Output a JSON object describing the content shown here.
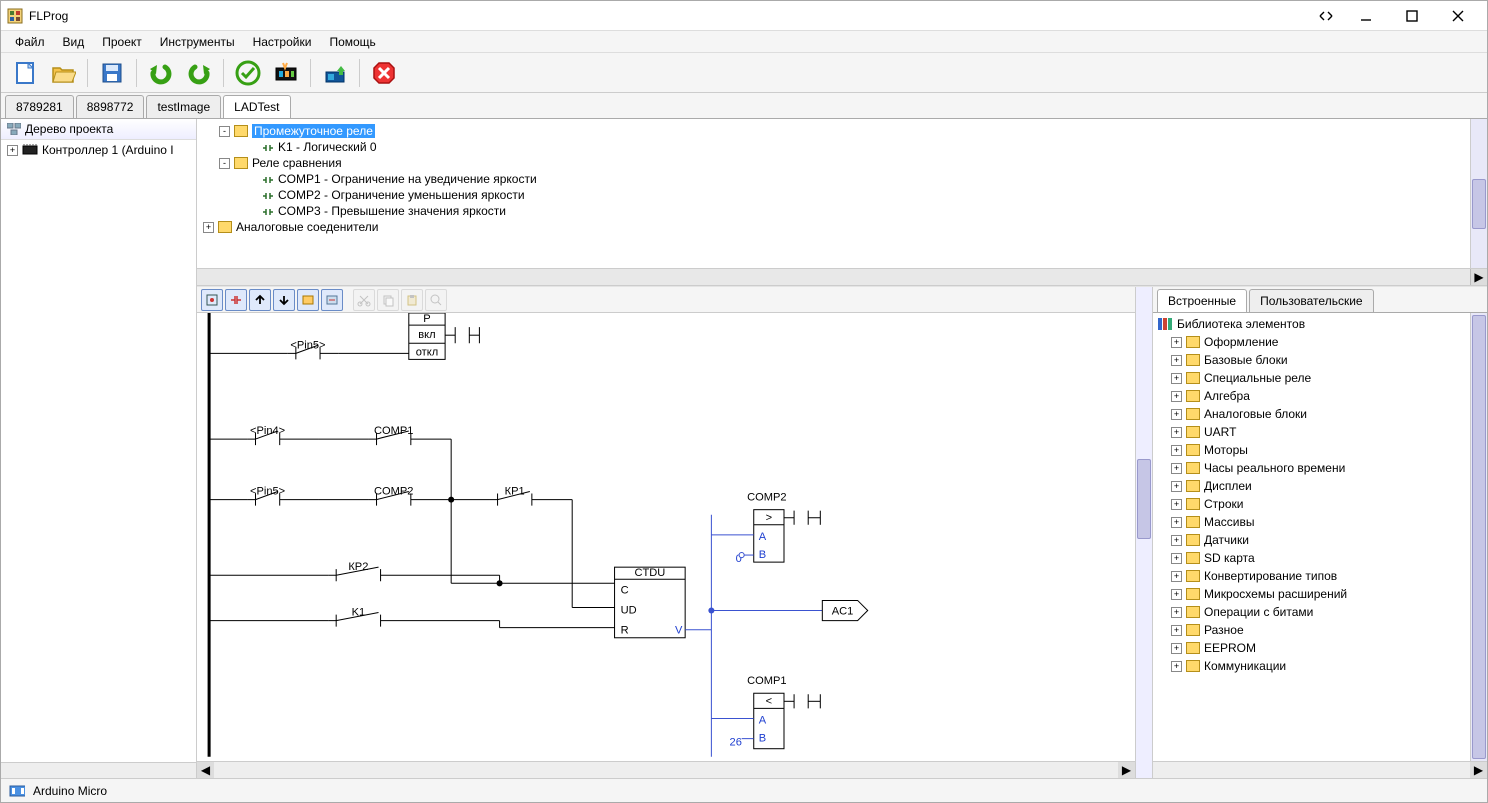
{
  "app": {
    "title": "FLProg"
  },
  "menu": [
    "Файл",
    "Вид",
    "Проект",
    "Инструменты",
    "Настройки",
    "Помощь"
  ],
  "doctabs": [
    {
      "label": "8789281",
      "active": false
    },
    {
      "label": "8898772",
      "active": false
    },
    {
      "label": "testImage",
      "active": false
    },
    {
      "label": "LADTest",
      "active": true
    }
  ],
  "leftpanel": {
    "header": "Дерево проекта",
    "items": [
      {
        "label": "Контроллер 1 (Arduino I"
      }
    ]
  },
  "uppertree": {
    "rows": [
      {
        "indent": 0,
        "exp": "-",
        "folder": true,
        "label": "Промежуточное реле",
        "selected": true
      },
      {
        "indent": 1,
        "exp": "",
        "folder": false,
        "label": "K1 - Логический 0"
      },
      {
        "indent": 0,
        "exp": "-",
        "folder": true,
        "label": "Реле сравнения"
      },
      {
        "indent": 1,
        "exp": "",
        "folder": false,
        "label": "COMP1 - Ограничение на уведичение яркости"
      },
      {
        "indent": 1,
        "exp": "",
        "folder": false,
        "label": "COMP2 - Ограничение уменьшения яркости"
      },
      {
        "indent": 1,
        "exp": "",
        "folder": false,
        "label": "COMP3 - Превышение значения яркости"
      },
      {
        "indent": -1,
        "exp": "+",
        "folder": true,
        "label": "Аналоговые соеденители"
      }
    ]
  },
  "rightpanel": {
    "tabs": [
      {
        "label": "Встроенные",
        "active": true
      },
      {
        "label": "Пользовательские",
        "active": false
      }
    ],
    "header": "Библиотека элементов",
    "items": [
      "Оформление",
      "Базовые блоки",
      "Специальные реле",
      "Алгебра",
      "Аналоговые блоки",
      "UART",
      "Моторы",
      "Часы реального времени",
      "Дисплеи",
      "Строки",
      "Массивы",
      "Датчики",
      "SD карта",
      "Конвертирование типов",
      "Микросхемы расширений",
      "Операции с битами",
      "Разное",
      "EEPROM",
      "Коммуникации"
    ]
  },
  "statusbar": {
    "board": "Arduino Micro"
  },
  "ladder": {
    "block_top": {
      "p": "P",
      "on": "вкл",
      "off": "откл"
    },
    "pin5a": "<Pin5>",
    "pin4": "<Pin4>",
    "comp1_top": "COMP1",
    "pin5b": "<Pin5>",
    "comp2_left": "COMP2",
    "kp1": "КР1",
    "kp2": "КР2",
    "k1": "K1",
    "ctdu": {
      "title": "CTDU",
      "c": "C",
      "ud": "UD",
      "r": "R",
      "v": "V"
    },
    "comp2_box": {
      "title": "COMP2",
      "op": ">",
      "a": "A",
      "b": "B",
      "zero": "0"
    },
    "ac1": "AC1",
    "comp1_box": {
      "title": "COMP1",
      "op": "<",
      "a": "A",
      "b": "B",
      "val": "26"
    }
  }
}
